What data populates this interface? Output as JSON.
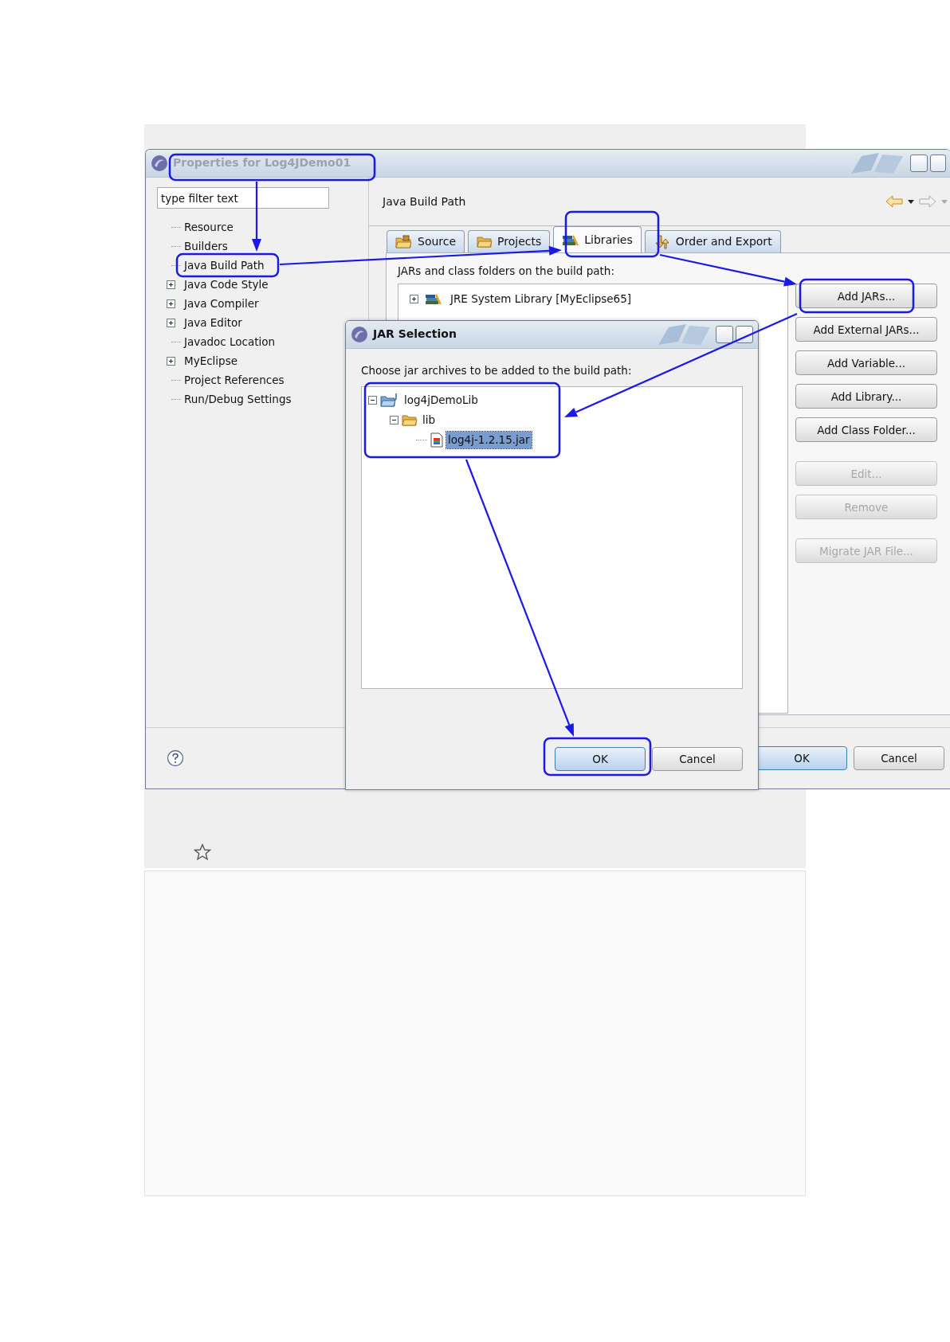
{
  "properties_window": {
    "title": "Properties for Log4JDemo01",
    "active": false,
    "filter": {
      "placeholder": "type filter text"
    },
    "tree": [
      {
        "label": "Resource",
        "expandable": false
      },
      {
        "label": "Builders",
        "expandable": false
      },
      {
        "label": "Java Build Path",
        "expandable": false
      },
      {
        "label": "Java Code Style",
        "expandable": true
      },
      {
        "label": "Java Compiler",
        "expandable": true
      },
      {
        "label": "Java Editor",
        "expandable": true
      },
      {
        "label": "Javadoc Location",
        "expandable": false
      },
      {
        "label": "MyEclipse",
        "expandable": true
      },
      {
        "label": "Project References",
        "expandable": false
      },
      {
        "label": "Run/Debug Settings",
        "expandable": false
      }
    ],
    "page_title": "Java Build Path",
    "tabs": [
      {
        "label": "Source",
        "kind": "source",
        "selected": false
      },
      {
        "label": "Projects",
        "kind": "projects",
        "selected": false
      },
      {
        "label": "Libraries",
        "kind": "libraries",
        "selected": true
      },
      {
        "label": "Order and Export",
        "kind": "order",
        "selected": false
      }
    ],
    "list_label": "JARs and class folders on the build path:",
    "libraries": [
      {
        "label": "JRE System Library [MyEclipse65]",
        "expanded": false
      }
    ],
    "side_button_groups": [
      [
        {
          "label": "Add JARs...",
          "disabled": false
        },
        {
          "label": "Add External JARs...",
          "disabled": false
        },
        {
          "label": "Add Variable...",
          "disabled": false
        },
        {
          "label": "Add Library...",
          "disabled": false
        },
        {
          "label": "Add Class Folder...",
          "disabled": false
        }
      ],
      [
        {
          "label": "Edit...",
          "disabled": true
        },
        {
          "label": "Remove",
          "disabled": true
        }
      ],
      [
        {
          "label": "Migrate JAR File...",
          "disabled": true
        }
      ]
    ],
    "footer_buttons": [
      {
        "label": "OK",
        "default": true
      },
      {
        "label": "Cancel",
        "default": false
      }
    ]
  },
  "jar_dialog": {
    "title": "JAR Selection",
    "active": true,
    "prompt": "Choose jar archives to be added to the build path:",
    "tree": [
      {
        "label": "log4jDemoLib",
        "kind": "project",
        "expanded": true,
        "selected": false,
        "children": [
          {
            "label": "lib",
            "kind": "folder",
            "expanded": true,
            "selected": false,
            "children": [
              {
                "label": "log4j-1.2.15.jar",
                "kind": "jar",
                "selected": true
              }
            ]
          }
        ]
      }
    ],
    "buttons": [
      {
        "label": "OK",
        "default": true
      },
      {
        "label": "Cancel",
        "default": false
      }
    ]
  }
}
